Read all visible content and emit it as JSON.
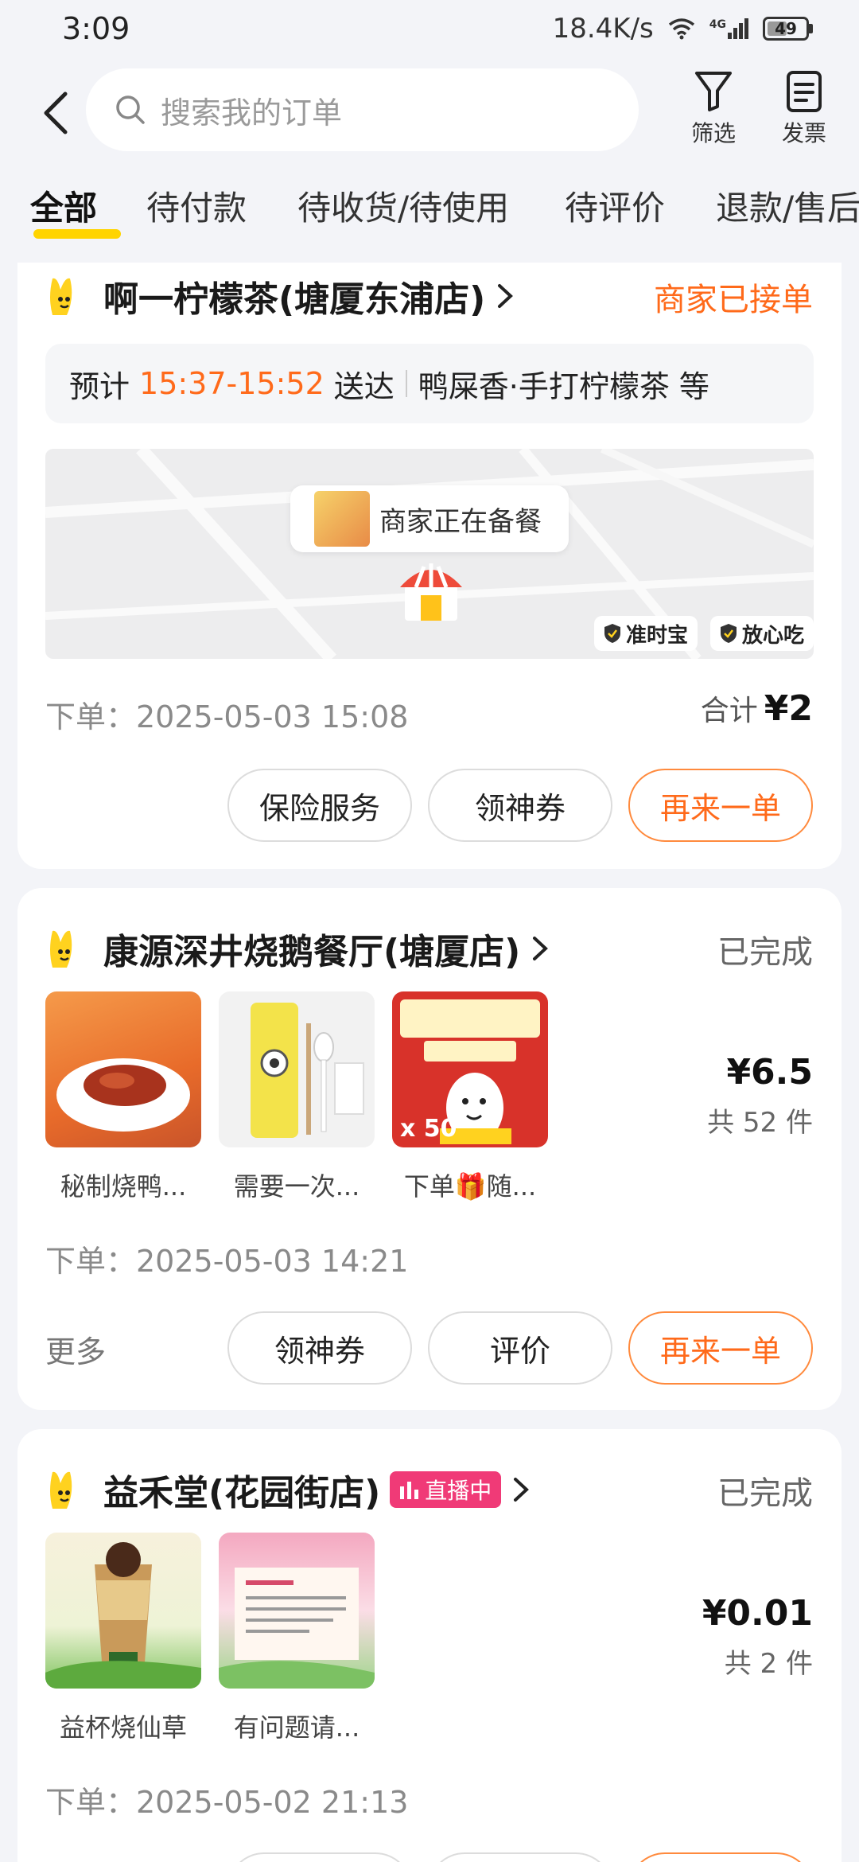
{
  "status_bar": {
    "time": "3:09",
    "net_speed": "18.4K/s",
    "signal": "4G",
    "battery": "49"
  },
  "header": {
    "search_placeholder": "搜索我的订单",
    "filter_label": "筛选",
    "invoice_label": "发票"
  },
  "tabs": [
    "全部",
    "待付款",
    "待收货/待使用",
    "待评价",
    "退款/售后"
  ],
  "orders": [
    {
      "store": "啊一柠檬茶(塘厦东浦店)",
      "status": "商家已接单",
      "eta_prefix": "预计",
      "eta_time": "15:37-15:52",
      "eta_suffix": "送达",
      "items_summary": "鸭屎香·手打柠檬茶 等",
      "map_status": "商家正在备餐",
      "badges": [
        "准时宝",
        "放心吃"
      ],
      "order_time": "下单：2025-05-03 15:08",
      "total_label": "合计",
      "total": "¥2",
      "buttons": [
        "保险服务",
        "领神券",
        "再来一单"
      ]
    },
    {
      "store": "康源深井烧鹅餐厅(塘厦店)",
      "status": "已完成",
      "items": [
        "秘制烧鸭...",
        "需要一次...",
        "下单🎁随..."
      ],
      "item3_badge": "x 50",
      "price": "¥6.5",
      "count": "共 52 件",
      "order_time": "下单：2025-05-03 14:21",
      "more": "更多",
      "buttons": [
        "领神券",
        "评价",
        "再来一单"
      ]
    },
    {
      "store": "益禾堂(花园街店)",
      "live": "直播中",
      "status": "已完成",
      "items": [
        "益杯烧仙草",
        "有问题请..."
      ],
      "price": "¥0.01",
      "count": "共 2 件",
      "order_time": "下单：2025-05-02 21:13"
    }
  ]
}
